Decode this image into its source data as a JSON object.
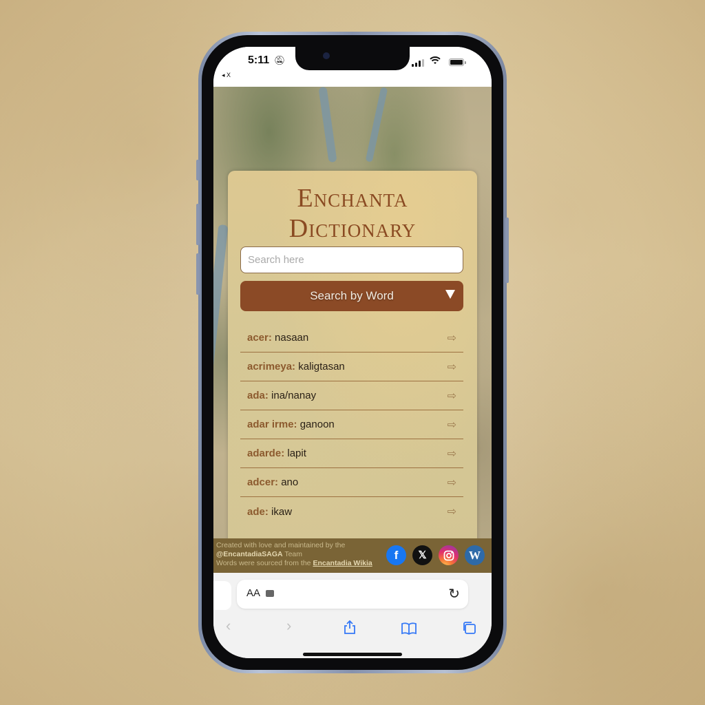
{
  "status_bar": {
    "time": "5:11",
    "silent_icon": "bell-slash-icon",
    "back_app_label": "◂ X",
    "signal_icon": "cellular-signal-icon",
    "wifi_icon": "wifi-icon",
    "battery_icon": "battery-icon"
  },
  "card": {
    "title_line1": "Enchanta",
    "title_line2": "Dictionary",
    "search_placeholder": "Search here",
    "search_value": "",
    "search_mode": "Search by Word",
    "accent_color": "#8b4a26"
  },
  "words": [
    {
      "term": "acer:",
      "definition": "nasaan"
    },
    {
      "term": "acrimeya:",
      "definition": "kaligtasan"
    },
    {
      "term": "ada:",
      "definition": "ina/nanay"
    },
    {
      "term": "adar irme:",
      "definition": "ganoon"
    },
    {
      "term": "adarde:",
      "definition": "lapit"
    },
    {
      "term": "adcer:",
      "definition": "ano"
    },
    {
      "term": "ade:",
      "definition": "ikaw"
    }
  ],
  "footer": {
    "line1": "Created with love and maintained by the",
    "handle": "@EncantadiaSAGA",
    "team": " Team",
    "line3_prefix": "Words were sourced from the ",
    "wiki_link": "Encantadia Wikia",
    "socials": [
      "facebook-icon",
      "x-icon",
      "instagram-icon",
      "wordpress-icon"
    ]
  },
  "browser": {
    "aa_label": "AA",
    "reload_icon": "reload-icon",
    "toolbar": [
      "back-icon",
      "forward-icon",
      "share-icon",
      "bookmarks-icon",
      "tabs-icon"
    ]
  }
}
